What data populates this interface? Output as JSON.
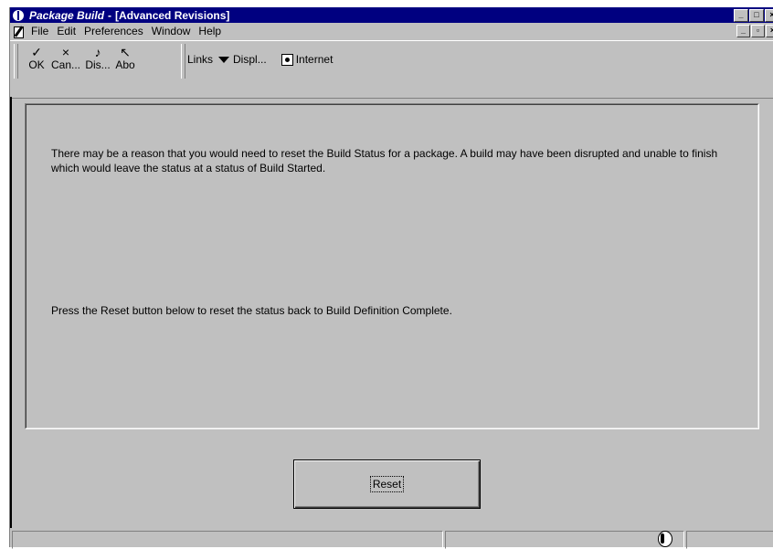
{
  "window": {
    "title_app": "Package Build",
    "title_sep": "-",
    "title_form": "[Advanced Revisions]",
    "controls": [
      "_",
      "□",
      "×"
    ]
  },
  "menubar": {
    "items": [
      {
        "label": "File"
      },
      {
        "label": "Edit"
      },
      {
        "label": "Preferences"
      },
      {
        "label": "Window"
      },
      {
        "label": "Help"
      }
    ],
    "mdi_controls": [
      "_",
      "▫",
      "×"
    ]
  },
  "toolbar": {
    "ok_label": "OK",
    "cancel_label": "Can...",
    "display_label": "Dis...",
    "about_label": "Abo",
    "links_label": "Links",
    "display_menu_label": "Displ...",
    "internet_label": "Internet"
  },
  "content": {
    "message_1": "There may be a reason that you would need to reset the Build Status for a package.  A build may have been disrupted and unable to finish which would leave the status at a status of Build Started.",
    "message_2": "Press the Reset button below to reset the status back to Build Definition Complete."
  },
  "reset_button": {
    "label": "Reset"
  }
}
